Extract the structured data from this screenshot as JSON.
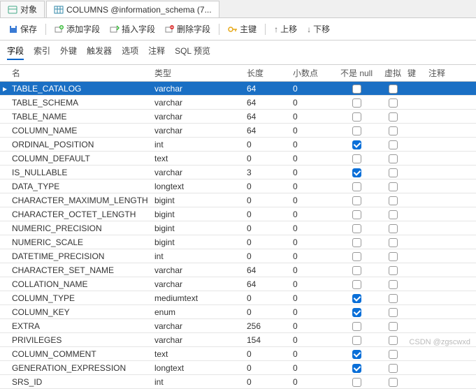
{
  "tabs": {
    "objects": "对象",
    "columns": "COLUMNS @information_schema (7..."
  },
  "toolbar": {
    "save": "保存",
    "addField": "添加字段",
    "insertField": "插入字段",
    "deleteField": "删除字段",
    "primaryKey": "主键",
    "moveUp": "上移",
    "moveDown": "下移"
  },
  "subtabs": {
    "fields": "字段",
    "indexes": "索引",
    "foreign": "外键",
    "triggers": "触发器",
    "options": "选项",
    "comment": "注释",
    "sql": "SQL 预览"
  },
  "headers": {
    "name": "名",
    "type": "类型",
    "length": "长度",
    "decimal": "小数点",
    "notnull": "不是 null",
    "virtual": "虚拟",
    "key": "键",
    "note": "注释"
  },
  "rows": [
    {
      "name": "TABLE_CATALOG",
      "type": "varchar",
      "len": "64",
      "dec": "0",
      "nn": false,
      "v": false
    },
    {
      "name": "TABLE_SCHEMA",
      "type": "varchar",
      "len": "64",
      "dec": "0",
      "nn": false,
      "v": false
    },
    {
      "name": "TABLE_NAME",
      "type": "varchar",
      "len": "64",
      "dec": "0",
      "nn": false,
      "v": false
    },
    {
      "name": "COLUMN_NAME",
      "type": "varchar",
      "len": "64",
      "dec": "0",
      "nn": false,
      "v": false
    },
    {
      "name": "ORDINAL_POSITION",
      "type": "int",
      "len": "0",
      "dec": "0",
      "nn": true,
      "v": false
    },
    {
      "name": "COLUMN_DEFAULT",
      "type": "text",
      "len": "0",
      "dec": "0",
      "nn": false,
      "v": false
    },
    {
      "name": "IS_NULLABLE",
      "type": "varchar",
      "len": "3",
      "dec": "0",
      "nn": true,
      "v": false
    },
    {
      "name": "DATA_TYPE",
      "type": "longtext",
      "len": "0",
      "dec": "0",
      "nn": false,
      "v": false
    },
    {
      "name": "CHARACTER_MAXIMUM_LENGTH",
      "type": "bigint",
      "len": "0",
      "dec": "0",
      "nn": false,
      "v": false
    },
    {
      "name": "CHARACTER_OCTET_LENGTH",
      "type": "bigint",
      "len": "0",
      "dec": "0",
      "nn": false,
      "v": false
    },
    {
      "name": "NUMERIC_PRECISION",
      "type": "bigint",
      "len": "0",
      "dec": "0",
      "nn": false,
      "v": false
    },
    {
      "name": "NUMERIC_SCALE",
      "type": "bigint",
      "len": "0",
      "dec": "0",
      "nn": false,
      "v": false
    },
    {
      "name": "DATETIME_PRECISION",
      "type": "int",
      "len": "0",
      "dec": "0",
      "nn": false,
      "v": false
    },
    {
      "name": "CHARACTER_SET_NAME",
      "type": "varchar",
      "len": "64",
      "dec": "0",
      "nn": false,
      "v": false
    },
    {
      "name": "COLLATION_NAME",
      "type": "varchar",
      "len": "64",
      "dec": "0",
      "nn": false,
      "v": false
    },
    {
      "name": "COLUMN_TYPE",
      "type": "mediumtext",
      "len": "0",
      "dec": "0",
      "nn": true,
      "v": false
    },
    {
      "name": "COLUMN_KEY",
      "type": "enum",
      "len": "0",
      "dec": "0",
      "nn": true,
      "v": false
    },
    {
      "name": "EXTRA",
      "type": "varchar",
      "len": "256",
      "dec": "0",
      "nn": false,
      "v": false
    },
    {
      "name": "PRIVILEGES",
      "type": "varchar",
      "len": "154",
      "dec": "0",
      "nn": false,
      "v": false
    },
    {
      "name": "COLUMN_COMMENT",
      "type": "text",
      "len": "0",
      "dec": "0",
      "nn": true,
      "v": false
    },
    {
      "name": "GENERATION_EXPRESSION",
      "type": "longtext",
      "len": "0",
      "dec": "0",
      "nn": true,
      "v": false
    },
    {
      "name": "SRS_ID",
      "type": "int",
      "len": "0",
      "dec": "0",
      "nn": false,
      "v": false
    }
  ],
  "watermark": "CSDN @zgscwxd"
}
